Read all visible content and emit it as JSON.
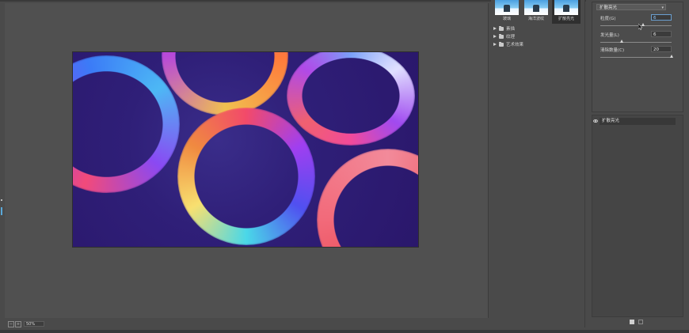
{
  "preview": {
    "zoom_minus": "−",
    "zoom_plus": "+",
    "zoom_value": "50%"
  },
  "gallery": {
    "thumbnails": [
      {
        "label": "玻璃"
      },
      {
        "label": "海洋波纹"
      },
      {
        "label": "扩散亮光"
      }
    ],
    "folders": [
      {
        "label": "素描"
      },
      {
        "label": "纹理"
      },
      {
        "label": "艺术效果"
      }
    ]
  },
  "settings": {
    "filter_name": "扩散亮光",
    "params": [
      {
        "label": "粒度(G)",
        "value": "6",
        "slider": 0.6
      },
      {
        "label": "发光量(L)",
        "value": "6",
        "slider": 0.3
      },
      {
        "label": "清除数量(C)",
        "value": "20",
        "slider": 1.0
      }
    ]
  },
  "layers": {
    "items": [
      {
        "label": "扩散亮光"
      }
    ]
  }
}
